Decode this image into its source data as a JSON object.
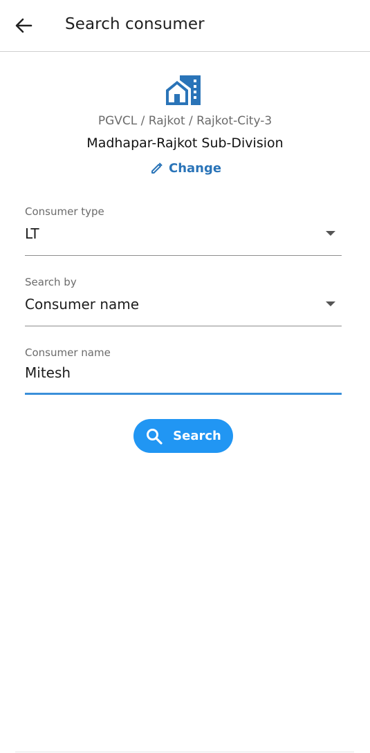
{
  "header": {
    "title": "Search consumer",
    "back_icon": "arrow-left-icon"
  },
  "office": {
    "icon": "office-building-icon",
    "breadcrumb": "PGVCL / Rajkot / Rajkot-City-3",
    "subdivision": "Madhapar-Rajkot Sub-Division",
    "change_label": "Change",
    "change_icon": "pencil-icon"
  },
  "form": {
    "consumer_type": {
      "label": "Consumer type",
      "value": "LT"
    },
    "search_by": {
      "label": "Search by",
      "value": "Consumer name"
    },
    "consumer_name": {
      "label": "Consumer name",
      "value": "Mitesh"
    }
  },
  "actions": {
    "search_label": "Search",
    "search_icon": "magnifier-icon"
  },
  "colors": {
    "accent": "#2196f3",
    "link": "#2a74b8",
    "active_underline": "#3a8fd9"
  }
}
